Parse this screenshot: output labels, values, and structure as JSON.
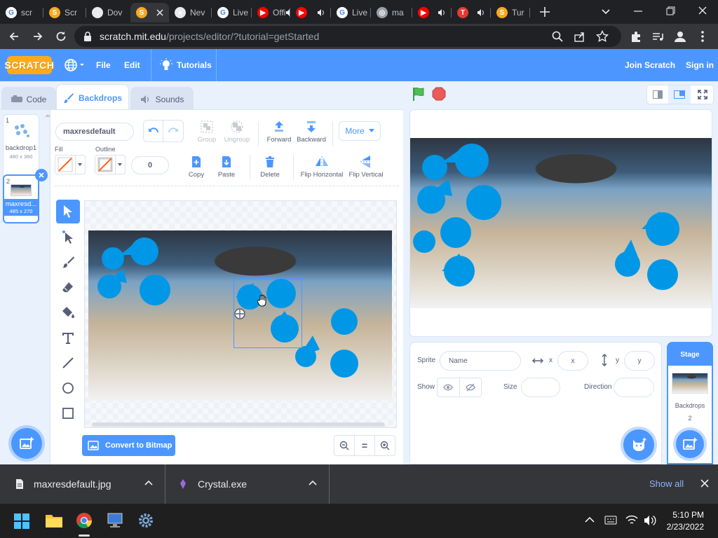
{
  "browser": {
    "tabs": [
      {
        "label": "scr",
        "icon": "google-icon",
        "color": "#ffffff"
      },
      {
        "label": "Scr",
        "icon": "scratch-icon",
        "color": "#f7a823"
      },
      {
        "label": "Dov",
        "icon": "download-icon",
        "color": "#e8eaed"
      },
      {
        "label": "",
        "icon": "scratch-icon",
        "color": "#f7a823"
      },
      {
        "label": "Nev",
        "icon": "chrome-icon",
        "color": "#e8eaed"
      },
      {
        "label": "Live",
        "icon": "google-icon",
        "color": "#ffffff"
      },
      {
        "label": "Offi",
        "icon": "youtube-icon",
        "color": "#ff0000"
      },
      {
        "label": "",
        "icon": "youtube-icon",
        "color": "#ff0000"
      },
      {
        "label": "Live",
        "icon": "google-icon",
        "color": "#ffffff"
      },
      {
        "label": "ma",
        "icon": "globe-icon",
        "color": "#9aa0a6"
      },
      {
        "label": "",
        "icon": "youtube-icon",
        "color": "#ff0000"
      },
      {
        "label": "",
        "icon": "tsm-icon",
        "color": "#e53935"
      },
      {
        "label": "Tur",
        "icon": "scratch-icon",
        "color": "#f7a823"
      }
    ],
    "url_host": "scratch.mit.edu",
    "url_path": "/projects/editor/?tutorial=getStarted"
  },
  "menu": {
    "logo": "SCRATCH",
    "file": "File",
    "edit": "Edit",
    "tutorials": "Tutorials",
    "join": "Join Scratch",
    "signin": "Sign in"
  },
  "editor_tabs": {
    "code": "Code",
    "backdrops": "Backdrops",
    "sounds": "Sounds"
  },
  "costumes": [
    {
      "num": "1",
      "name": "backdrop1",
      "size": "480 x 360"
    },
    {
      "num": "2",
      "name": "maxresd...",
      "size": "485 x 270"
    }
  ],
  "paint": {
    "costume_name": "maxresdefault",
    "group": "Group",
    "ungroup": "Ungroup",
    "forward": "Forward",
    "backward": "Backward",
    "more": "More",
    "fill_label": "Fill",
    "outline_label": "Outline",
    "outline_width": "0",
    "copy": "Copy",
    "paste": "Paste",
    "delete": "Delete",
    "flip_h": "Flip Horizontal",
    "flip_v": "Flip Vertical",
    "convert": "Convert to Bitmap",
    "zoom_reset": "="
  },
  "sprite": {
    "label": "Sprite",
    "name_placeholder": "Name",
    "x_label": "x",
    "x_placeholder": "x",
    "y_label": "y",
    "y_placeholder": "y",
    "show_label": "Show",
    "size_label": "Size",
    "direction_label": "Direction"
  },
  "stage_col": {
    "title": "Stage",
    "backdrops_label": "Backdrops",
    "backdrops_count": "2"
  },
  "downloads": [
    {
      "name": "maxresdefault.jpg"
    },
    {
      "name": "Crystal.exe"
    }
  ],
  "downloads_show_all": "Show all",
  "taskbar": {
    "time": "5:10 PM",
    "date": "2/23/2022"
  },
  "colors": {
    "scratch_blue": "#4c97ff",
    "paint_blue": "#0097e6",
    "chrome_dark": "#202124"
  }
}
